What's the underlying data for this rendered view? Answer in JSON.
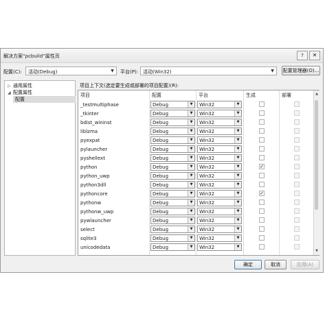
{
  "window": {
    "title": "解决方案“pcbuild”属性页",
    "help": "?",
    "close": "✕"
  },
  "toolbar": {
    "config_label": "配置(C):",
    "config_value": "活动(Debug)",
    "platform_label": "平台(P):",
    "platform_value": "活动(Win32)",
    "manager_button": "配置管理器(O)..."
  },
  "tree": {
    "items": [
      {
        "label": "通用属性",
        "twisty": "▷"
      },
      {
        "label": "配置属性",
        "twisty": "◢"
      },
      {
        "label": "配置"
      }
    ]
  },
  "grid": {
    "caption": "项目上下文(选定要生成或部署的项目配置)(R):",
    "headers": [
      "项目",
      "配置",
      "平台",
      "生成",
      "部署"
    ],
    "rows": [
      {
        "project": "_testmultiphase",
        "config": "Debug",
        "platform": "Win32",
        "build": false,
        "deploy": false
      },
      {
        "project": "_tkinter",
        "config": "Debug",
        "platform": "Win32",
        "build": false,
        "deploy": false
      },
      {
        "project": "bdist_wininst",
        "config": "Debug",
        "platform": "Win32",
        "build": false,
        "deploy": false
      },
      {
        "project": "liblzma",
        "config": "Debug",
        "platform": "Win32",
        "build": false,
        "deploy": false
      },
      {
        "project": "pyexpat",
        "config": "Debug",
        "platform": "Win32",
        "build": false,
        "deploy": false
      },
      {
        "project": "pylauncher",
        "config": "Debug",
        "platform": "Win32",
        "build": false,
        "deploy": false
      },
      {
        "project": "pyshellext",
        "config": "Debug",
        "platform": "Win32",
        "build": false,
        "deploy": false
      },
      {
        "project": "python",
        "config": "Debug",
        "platform": "Win32",
        "build": true,
        "deploy": false
      },
      {
        "project": "python_uwp",
        "config": "Debug",
        "platform": "Win32",
        "build": false,
        "deploy": false
      },
      {
        "project": "python3dll",
        "config": "Debug",
        "platform": "Win32",
        "build": false,
        "deploy": false
      },
      {
        "project": "pythoncore",
        "config": "Debug",
        "platform": "Win32",
        "build": true,
        "deploy": false
      },
      {
        "project": "pythonw",
        "config": "Debug",
        "platform": "Win32",
        "build": false,
        "deploy": false
      },
      {
        "project": "pythonw_uwp",
        "config": "Debug",
        "platform": "Win32",
        "build": false,
        "deploy": false
      },
      {
        "project": "pywlauncher",
        "config": "Debug",
        "platform": "Win32",
        "build": false,
        "deploy": false
      },
      {
        "project": "select",
        "config": "Debug",
        "platform": "Win32",
        "build": false,
        "deploy": false
      },
      {
        "project": "sqlite3",
        "config": "Debug",
        "platform": "Win32",
        "build": false,
        "deploy": false
      },
      {
        "project": "unicodedata",
        "config": "Debug",
        "platform": "Win32",
        "build": false,
        "deploy": false
      }
    ]
  },
  "footer": {
    "ok": "确定",
    "cancel": "取消",
    "apply": "应用(A)"
  },
  "icons": {
    "dropdown": "▼",
    "check": "✓"
  }
}
